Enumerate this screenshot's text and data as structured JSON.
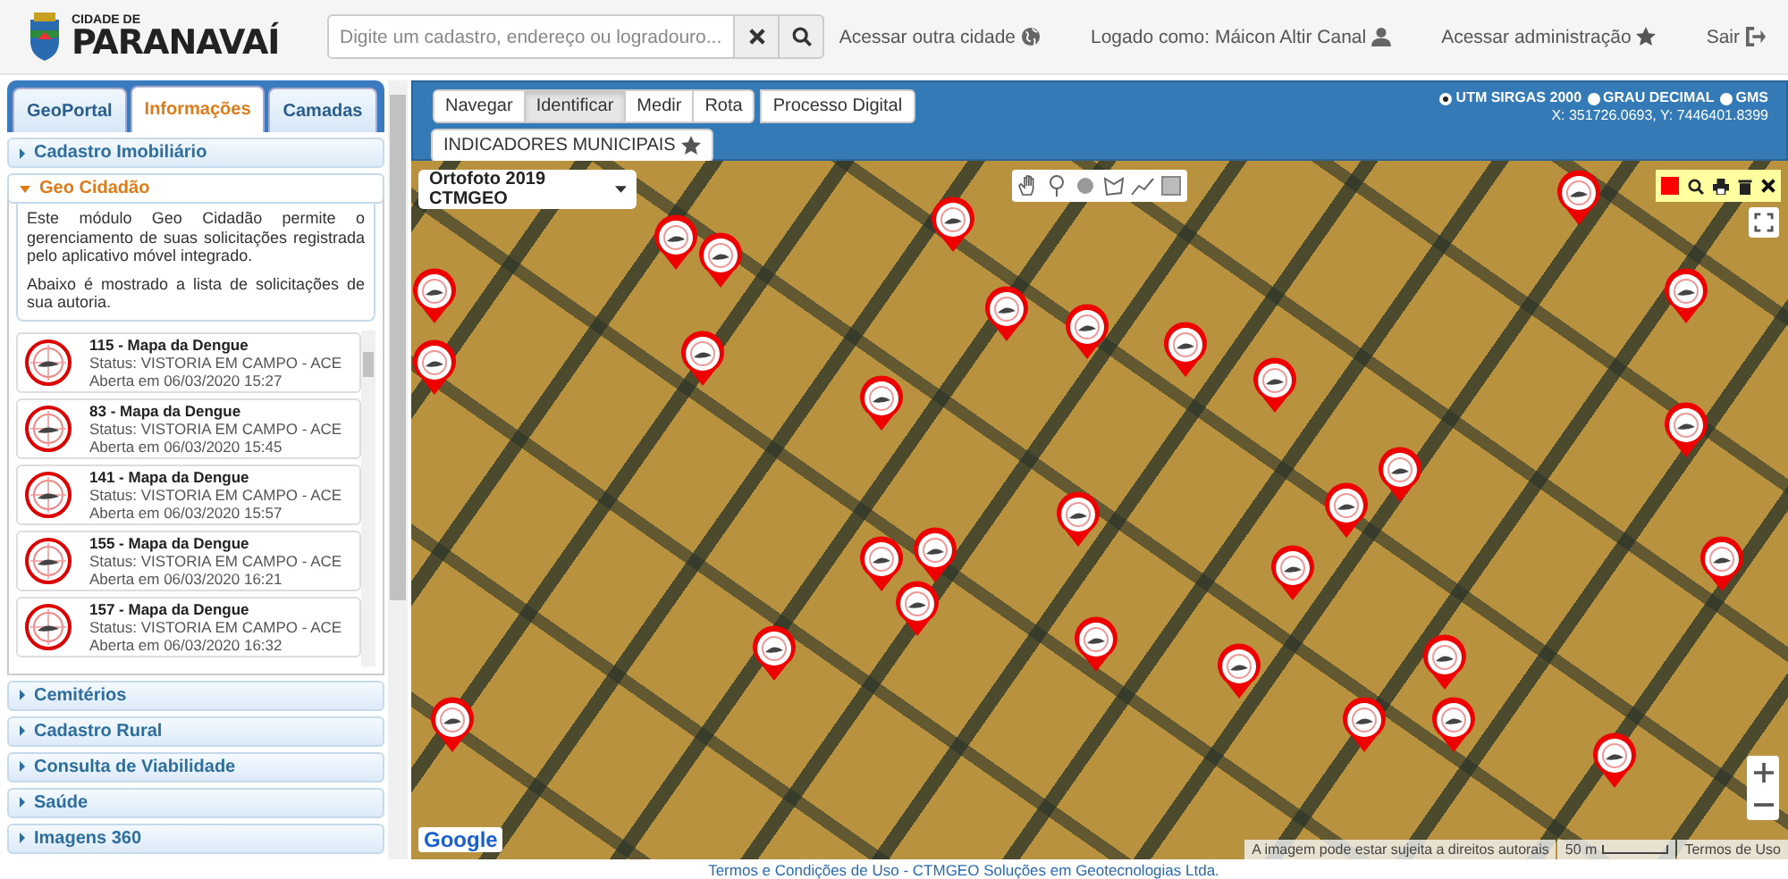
{
  "header": {
    "logo": {
      "small": "CIDADE DE",
      "big": "PARANAVAÍ"
    },
    "search": {
      "placeholder": "Digite um cadastro, endereço ou logradouro..."
    },
    "links": [
      {
        "label": "Acessar outra cidade"
      },
      {
        "label": "Logado como: Máicon Altir Canal"
      },
      {
        "label": "Acessar administração"
      },
      {
        "label": "Sair"
      }
    ]
  },
  "sidebar": {
    "tabs": [
      {
        "label": "GeoPortal",
        "selected": false
      },
      {
        "label": "Informações",
        "selected": true
      },
      {
        "label": "Camadas",
        "selected": false
      }
    ],
    "sections_before": [
      {
        "label": "Cadastro Imobiliário",
        "expanded": false
      }
    ],
    "open_section": {
      "label": "Geo Cidadão",
      "expanded": true,
      "paragraphs": [
        "Este módulo Geo Cidadão permite o gerenciamento de suas solicitações registrada pelo aplicativo móvel integrado.",
        "Abaixo é mostrado a lista de solicitações de sua autoria."
      ],
      "requests": [
        {
          "title": "115 - Mapa da Dengue",
          "status": "Status: VISTORIA EM CAMPO - ACE",
          "opened": "Aberta em 06/03/2020 15:27"
        },
        {
          "title": "83 - Mapa da Dengue",
          "status": "Status: VISTORIA EM CAMPO - ACE",
          "opened": "Aberta em 06/03/2020 15:45"
        },
        {
          "title": "141 - Mapa da Dengue",
          "status": "Status: VISTORIA EM CAMPO - ACE",
          "opened": "Aberta em 06/03/2020 15:57"
        },
        {
          "title": "155 - Mapa da Dengue",
          "status": "Status: VISTORIA EM CAMPO - ACE",
          "opened": "Aberta em 06/03/2020 16:21"
        },
        {
          "title": "157 - Mapa da Dengue",
          "status": "Status: VISTORIA EM CAMPO - ACE",
          "opened": "Aberta em 06/03/2020 16:32"
        }
      ]
    },
    "sections_after": [
      {
        "label": "Cemitérios",
        "expanded": false
      },
      {
        "label": "Cadastro Rural",
        "expanded": false
      },
      {
        "label": "Consulta de Viabilidade",
        "expanded": false
      },
      {
        "label": "Saúde",
        "expanded": false
      },
      {
        "label": "Imagens 360",
        "expanded": false
      }
    ]
  },
  "toolbar": {
    "groups": [
      [
        {
          "label": "Navegar",
          "selected": false
        },
        {
          "label": "Identificar",
          "selected": true
        },
        {
          "label": "Medir",
          "selected": false
        },
        {
          "label": "Rota",
          "selected": false
        }
      ],
      [
        {
          "label": "Processo Digital",
          "selected": false
        }
      ]
    ],
    "indicators": {
      "label": "INDICADORES MUNICIPAIS"
    },
    "coordinate_systems": [
      {
        "label": "UTM SIRGAS 2000",
        "selected": true
      },
      {
        "label": "GRAU DECIMAL",
        "selected": false
      },
      {
        "label": "GMS",
        "selected": false
      }
    ],
    "coordinates": "X: 351726.0693, Y: 7446401.8399"
  },
  "map": {
    "layer": "Ortofoto 2019 CTMGEO",
    "google": "Google",
    "attribution": "A imagem pode estar sujeita a direitos autorais",
    "scale": "50 m",
    "terms": "Termos de Uso"
  },
  "footer": "Termos e Condições de Uso - CTMGEO Soluções em Geotecnologias Ltda."
}
